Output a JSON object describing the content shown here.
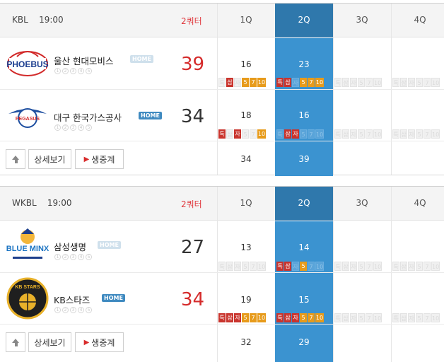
{
  "games": [
    {
      "league": "KBL",
      "time": "19:00",
      "period": "2쿼터",
      "quarters": [
        "1Q",
        "2Q",
        "3Q",
        "4Q"
      ],
      "teams": [
        {
          "name": "울산 현대모비스",
          "home_badge": "HOME",
          "home_active": false,
          "logo_text": "PHOEBUS",
          "score": "39",
          "q_scores": [
            "16",
            "23",
            "",
            ""
          ],
          "chips_q1": [
            "특",
            "삼",
            "자",
            "5",
            "7",
            "10"
          ],
          "chips_q2": [
            "특",
            "삼",
            "자",
            "5",
            "7",
            "10"
          ]
        },
        {
          "name": "대구 한국가스공사",
          "home_badge": "HOME",
          "home_active": true,
          "logo_text": "PEGASUS",
          "score": "34",
          "q_scores": [
            "18",
            "16",
            "",
            ""
          ],
          "chips_q1": [
            "특",
            "삼",
            "자",
            "5",
            "7",
            "10"
          ],
          "chips_q2": [
            "특",
            "삼",
            "자",
            "5",
            "7",
            "10"
          ]
        }
      ],
      "totals": [
        "34",
        "39"
      ],
      "buttons": {
        "detail": "상세보기",
        "live": "생중계"
      }
    },
    {
      "league": "WKBL",
      "time": "19:00",
      "period": "2쿼터",
      "quarters": [
        "1Q",
        "2Q",
        "3Q",
        "4Q"
      ],
      "teams": [
        {
          "name": "삼성생명",
          "home_badge": "HOME",
          "home_active": false,
          "logo_text": "BLUE MINX",
          "score": "27",
          "q_scores": [
            "13",
            "14",
            "",
            ""
          ],
          "chips_q1": [
            "특",
            "삼",
            "자",
            "5",
            "7",
            "10"
          ],
          "chips_q2": [
            "특",
            "삼",
            "자",
            "5",
            "7",
            "10"
          ]
        },
        {
          "name": "KB스타즈",
          "home_badge": "HOME",
          "home_active": true,
          "logo_text": "KB STARS",
          "score": "34",
          "q_scores": [
            "19",
            "15",
            "",
            ""
          ],
          "chips_q1": [
            "특",
            "삼",
            "자",
            "5",
            "7",
            "10"
          ],
          "chips_q2": [
            "특",
            "삼",
            "자",
            "5",
            "7",
            "10"
          ]
        }
      ],
      "totals": [
        "32",
        "29"
      ],
      "buttons": {
        "detail": "상세보기",
        "live": "생중계"
      }
    }
  ],
  "mini_dots": [
    "1",
    "2",
    "3",
    "4",
    "5"
  ],
  "colors": {
    "active_column": "#3b93d0",
    "active_header": "#2f78ac",
    "accent_red": "#d52b2b",
    "chip_red": "#c9342d",
    "chip_orange": "#e79b1b"
  },
  "icons": {
    "scroll_up": "arrow-up-icon",
    "live": "play-triangle-icon"
  }
}
